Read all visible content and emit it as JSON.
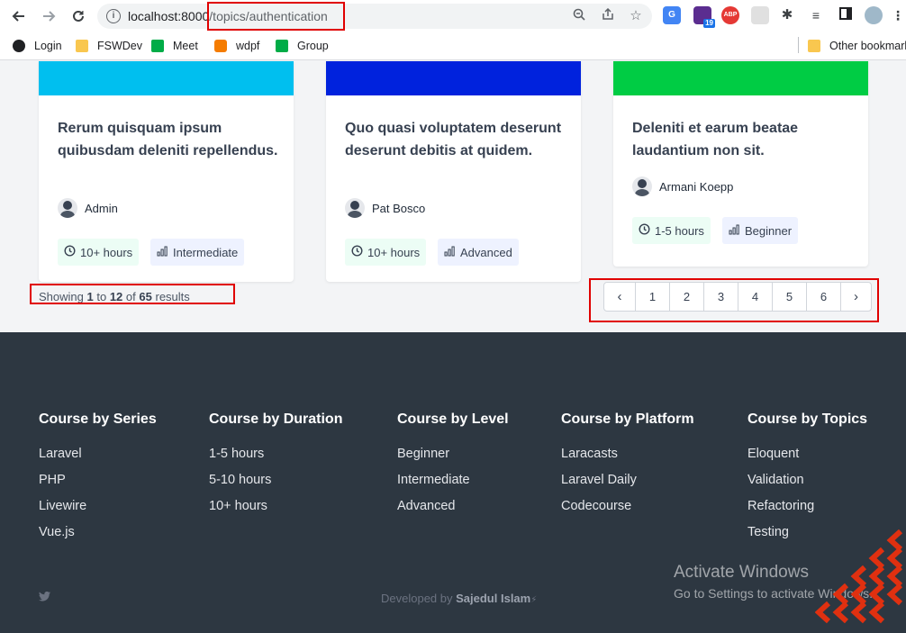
{
  "browser": {
    "url_host": "localhost:8000",
    "url_path": "/topics/authentication",
    "bookmarks": [
      {
        "label": "Login"
      },
      {
        "label": "FSWDev"
      },
      {
        "label": "Meet"
      },
      {
        "label": "wdpf"
      },
      {
        "label": "Group"
      }
    ],
    "other_bookmarks": "Other bookmarks",
    "extension_badge": "19",
    "abp_label": "ABP"
  },
  "cards": [
    {
      "title": "Rerum quisquam ipsum quibusdam deleniti repellendus.",
      "author": "Admin",
      "duration": "10+ hours",
      "level": "Intermediate",
      "color": "#00bfef"
    },
    {
      "title": "Quo quasi voluptatem deserunt deserunt debitis at quidem.",
      "author": "Pat Bosco",
      "duration": "10+ hours",
      "level": "Advanced",
      "color": "#0022dd"
    },
    {
      "title": "Deleniti et earum beatae laudantium non sit.",
      "author": "Armani Koepp",
      "duration": "1-5 hours",
      "level": "Beginner",
      "color": "#00cc44"
    }
  ],
  "results": {
    "prefix": "Showing",
    "from": "1",
    "to_word": "to",
    "to": "12",
    "of_word": "of",
    "total": "65",
    "suffix": "results"
  },
  "pagination": {
    "prev": "‹",
    "pages": [
      "1",
      "2",
      "3",
      "4",
      "5",
      "6"
    ],
    "next": "›"
  },
  "footer": {
    "columns": [
      {
        "heading": "Course by Series",
        "links": [
          "Laravel",
          "PHP",
          "Livewire",
          "Vue.js"
        ]
      },
      {
        "heading": "Course by Duration",
        "links": [
          "1-5 hours",
          "5-10 hours",
          "10+ hours"
        ]
      },
      {
        "heading": "Course by Level",
        "links": [
          "Beginner",
          "Intermediate",
          "Advanced"
        ]
      },
      {
        "heading": "Course by Platform",
        "links": [
          "Laracasts",
          "Laravel Daily",
          "Codecourse"
        ]
      },
      {
        "heading": "Course by Topics",
        "links": [
          "Eloquent",
          "Validation",
          "Refactoring",
          "Testing"
        ]
      }
    ],
    "credit_prefix": "Developed by",
    "credit_name": "Sajedul Islam"
  },
  "windows_notice": {
    "title": "Activate Windows",
    "subtitle": "Go to Settings to activate Windows."
  },
  "colors": {
    "highlight": "#e00000",
    "footer_bg": "#2d3741"
  }
}
